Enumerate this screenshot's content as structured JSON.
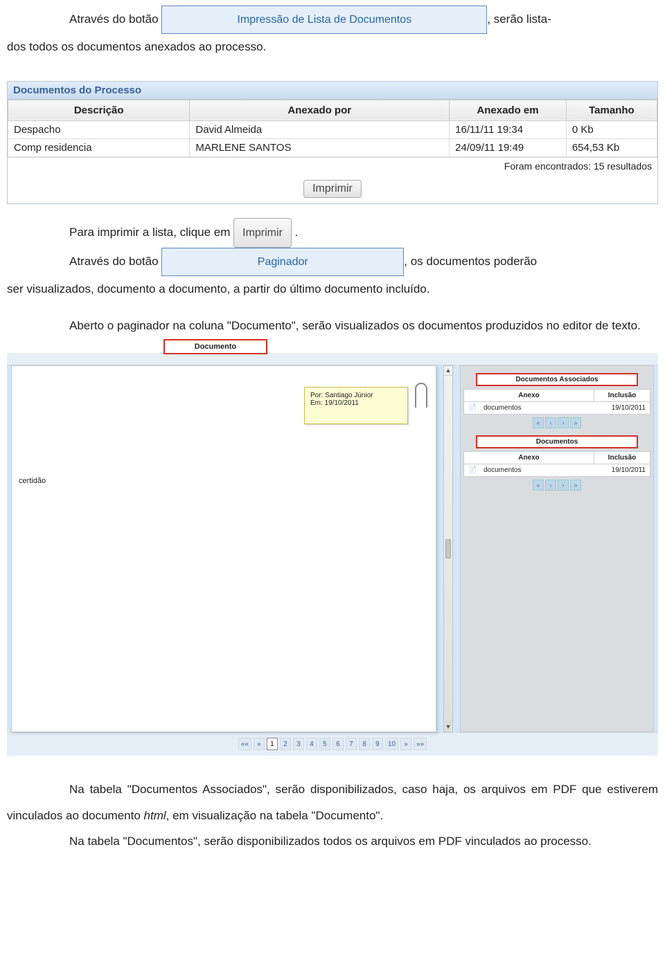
{
  "intro": {
    "p1a": "Através do botão",
    "btn1": "Impressão de Lista de Documentos",
    "p1b": ", serão lista-",
    "p1c": "dos todos os documentos anexados ao processo."
  },
  "docpanel": {
    "title": "Documentos do Processo",
    "cols": [
      "Descrição",
      "Anexado por",
      "Anexado em",
      "Tamanho"
    ],
    "rows": [
      {
        "desc": "Despacho",
        "por": "David Almeida",
        "em": "16/11/11 19:34",
        "tam": "0 Kb"
      },
      {
        "desc": "Comp residencia",
        "por": "MARLENE SANTOS",
        "em": "24/09/11 19:49",
        "tam": "654,53 Kb"
      }
    ],
    "footer": "Foram encontrados: 15 resultados",
    "print_btn": "Imprimir"
  },
  "mid": {
    "p2a": "Para imprimir a lista, clique em ",
    "btn2": "Imprimir",
    "p2b": " .",
    "p3a": "Através do botão ",
    "btn3": "Paginador",
    "p3b": ", os documentos poderão",
    "p3c": "ser visualizados, documento a documento, a partir do último documento incluído.",
    "p4": "Aberto o paginador na coluna \"Documento\", serão visualizados os documentos produzidos no editor de texto."
  },
  "viewer": {
    "tab_documento": "Documento",
    "sticky_por": "Por:  Santiago Júnior",
    "sticky_em": "Em:  19/10/2011",
    "certidao": "certidão",
    "assoc_hdr": "Documentos Associados",
    "mini_cols": [
      "Anexo",
      "Inclusão"
    ],
    "mini_rows": [
      {
        "nome": "documentos",
        "data": "19/10/2011"
      }
    ],
    "pager_mini": [
      "«",
      "‹",
      "›",
      "»"
    ],
    "docs_hdr": "Documentos",
    "mini2_rows": [
      {
        "nome": "documentos",
        "data": "19/10/2011"
      }
    ],
    "pager": [
      "««",
      "«",
      "1",
      "2",
      "3",
      "4",
      "5",
      "6",
      "7",
      "8",
      "9",
      "10",
      "»",
      "»»"
    ]
  },
  "outro": {
    "p5": "Na tabela \"Documentos Associados\", serão disponibilizados, caso haja, os arquivos em PDF que estiverem vinculados ao documento ",
    "p5it": "html",
    "p5b": ", em visualização na tabela \"Documento\".",
    "p6": "Na tabela \"Documentos\", serão disponibilizados todos os arquivos em PDF vinculados ao processo."
  }
}
